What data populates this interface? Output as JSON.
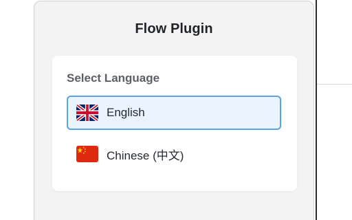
{
  "popup": {
    "title": "Flow Plugin"
  },
  "language_card": {
    "label": "Select Language",
    "options": [
      {
        "label": "English",
        "flag_icon": "uk-flag-icon",
        "selected": true
      },
      {
        "label": "Chinese (中文)",
        "flag_icon": "china-flag-icon",
        "selected": false
      }
    ]
  },
  "colors": {
    "popup_background": "#f3f3f3",
    "card_background": "#ffffff",
    "selected_background": "#eaf4ff",
    "selected_border": "#5aa2e8",
    "title_text": "#1f2328",
    "label_text": "#5c5f66"
  }
}
